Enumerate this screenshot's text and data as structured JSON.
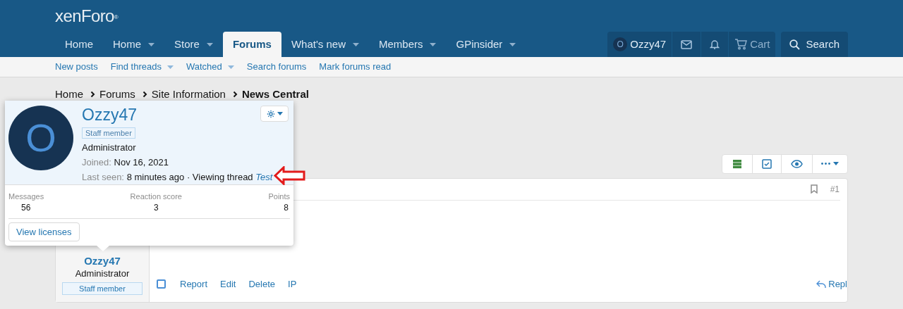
{
  "logo": {
    "text": "xenForo",
    "mark": "®"
  },
  "nav_tabs": [
    {
      "label": "Home",
      "selected": false,
      "has_menu": false
    },
    {
      "label": "Home",
      "selected": false,
      "has_menu": true
    },
    {
      "label": "Store",
      "selected": false,
      "has_menu": true
    },
    {
      "label": "Forums",
      "selected": true,
      "has_menu": false
    },
    {
      "label": "What's new",
      "selected": false,
      "has_menu": true
    },
    {
      "label": "Members",
      "selected": false,
      "has_menu": true
    },
    {
      "label": "GPinsider",
      "selected": false,
      "has_menu": true
    }
  ],
  "user_nav": {
    "avatar_letter": "O",
    "username": "Ozzy47",
    "cart": "Cart",
    "search": "Search"
  },
  "sub_nav": [
    {
      "label": "New posts",
      "has_menu": false
    },
    {
      "label": "Find threads",
      "has_menu": true
    },
    {
      "label": "Watched",
      "has_menu": true
    },
    {
      "label": "Search forums",
      "has_menu": false
    },
    {
      "label": "Mark forums read",
      "has_menu": false
    }
  ],
  "breadcrumbs": [
    {
      "label": "Home",
      "current": false
    },
    {
      "label": "Forums",
      "current": false
    },
    {
      "label": "Site Information",
      "current": false
    },
    {
      "label": "News Central",
      "current": true
    }
  ],
  "member_tooltip": {
    "avatar_letter": "O",
    "username": "Ozzy47",
    "badge": "Staff member",
    "title": "Administrator",
    "joined_label": "Joined:",
    "joined": "Nov 16, 2021",
    "last_seen_label": "Last seen:",
    "last_seen": "8 minutes ago · Viewing thread",
    "thread_link": "Test",
    "stats": [
      {
        "label": "Messages",
        "value": "56"
      },
      {
        "label": "Reaction score",
        "value": "3"
      },
      {
        "label": "Points",
        "value": "8"
      }
    ],
    "button": "View licenses"
  },
  "post": {
    "checked": false,
    "username": "Ozzy47",
    "title": "Administrator",
    "badge": "Staff member",
    "number": "#1",
    "actions": [
      "Report",
      "Edit",
      "Delete",
      "IP"
    ],
    "reply": "Repl"
  }
}
